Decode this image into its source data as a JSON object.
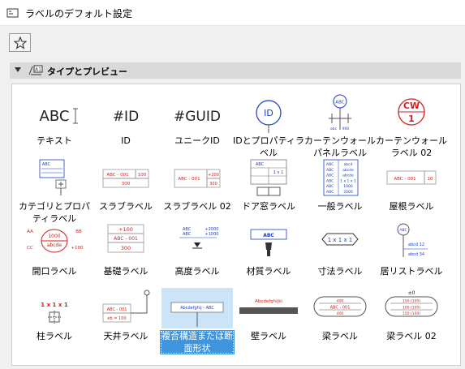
{
  "window": {
    "title": "ラベルのデフォルト設定"
  },
  "toolbar": {
    "favorites_icon": "star-icon"
  },
  "section": {
    "label": "タイプとプレビュー",
    "expanded": true
  },
  "colors": {
    "accent_red": "#d42020",
    "accent_blue": "#1a3fc2",
    "selection": "#3e95dd"
  },
  "labels": [
    {
      "name": "テキスト",
      "preview": "text",
      "text": "ABC"
    },
    {
      "name": "ID",
      "preview": "id",
      "text": "#ID"
    },
    {
      "name": "ユニークID",
      "preview": "guid",
      "text": "#GUID"
    },
    {
      "name": "IDとプロパティラベル",
      "preview": "circle-id",
      "text": "ID"
    },
    {
      "name": "カーテンウォールパネルラベル",
      "preview": "cw-panel",
      "text": "ABC",
      "sub": "abc 900"
    },
    {
      "name": "カーテンウォールラベル 02",
      "preview": "cw",
      "text": "CW",
      "sub": "1"
    },
    {
      "name": "カテゴリとプロパティラベル",
      "preview": "category",
      "text": "ABC"
    },
    {
      "name": "スラブラベル",
      "preview": "slab",
      "text": "ABC - 001",
      "sub": "100",
      "sub2": "300"
    },
    {
      "name": "スラブラベル 02",
      "preview": "slab2",
      "text": "ABC - 001",
      "sub": "+200",
      "sub2": "300"
    },
    {
      "name": "ドア窓ラベル",
      "preview": "door",
      "text": "ABC"
    },
    {
      "name": "一般ラベル",
      "preview": "general",
      "text": "ABC"
    },
    {
      "name": "屋根ラベル",
      "preview": "roof",
      "text": "ABC - 001",
      "sub": "10"
    },
    {
      "name": "開口ラベル",
      "preview": "opening",
      "text": "1000",
      "sub": "abcde"
    },
    {
      "name": "基礎ラベル",
      "preview": "foundation",
      "text": "+100",
      "sub": "ABC - 001",
      "sub2": "300"
    },
    {
      "name": "高度ラベル",
      "preview": "elevation",
      "text": "ABC",
      "sub": "+2000"
    },
    {
      "name": "材質ラベル",
      "preview": "material",
      "text": "ABC"
    },
    {
      "name": "寸法ラベル",
      "preview": "dimension",
      "text": "1 x 1 x 1"
    },
    {
      "name": "居リストラベル",
      "preview": "zone",
      "text": "ABC",
      "sub": "abcd 12",
      "sub2": "abcd 34"
    },
    {
      "name": "柱ラベル",
      "preview": "column",
      "text": "1 x 1 x 1"
    },
    {
      "name": "天井ラベル",
      "preview": "ceiling",
      "text": "ABC - 001",
      "sub": "eb = 100"
    },
    {
      "name": "複合構造または断面形状",
      "preview": "composite",
      "text": "Abcdefghij - ABC",
      "selected": true
    },
    {
      "name": "壁ラベル",
      "preview": "wall",
      "text": "Abcdefghijkl"
    },
    {
      "name": "梁ラベル",
      "preview": "beam",
      "text": "ABC - 001"
    },
    {
      "name": "梁ラベル 02",
      "preview": "beam2",
      "text": "±0",
      "sub": "150 (100)"
    }
  ]
}
